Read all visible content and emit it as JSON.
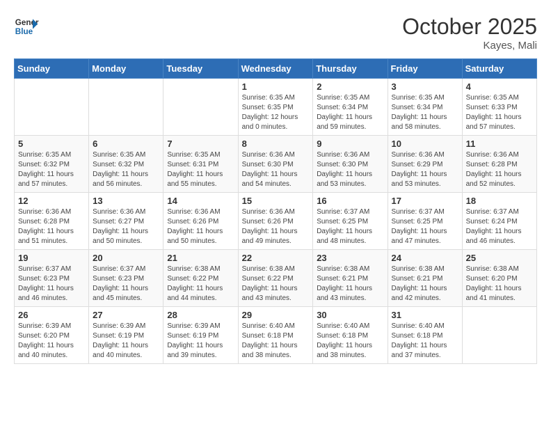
{
  "header": {
    "logo_line1": "General",
    "logo_line2": "Blue",
    "month": "October 2025",
    "location": "Kayes, Mali"
  },
  "weekdays": [
    "Sunday",
    "Monday",
    "Tuesday",
    "Wednesday",
    "Thursday",
    "Friday",
    "Saturday"
  ],
  "weeks": [
    [
      {
        "day": "",
        "info": ""
      },
      {
        "day": "",
        "info": ""
      },
      {
        "day": "",
        "info": ""
      },
      {
        "day": "1",
        "info": "Sunrise: 6:35 AM\nSunset: 6:35 PM\nDaylight: 12 hours\nand 0 minutes."
      },
      {
        "day": "2",
        "info": "Sunrise: 6:35 AM\nSunset: 6:34 PM\nDaylight: 11 hours\nand 59 minutes."
      },
      {
        "day": "3",
        "info": "Sunrise: 6:35 AM\nSunset: 6:34 PM\nDaylight: 11 hours\nand 58 minutes."
      },
      {
        "day": "4",
        "info": "Sunrise: 6:35 AM\nSunset: 6:33 PM\nDaylight: 11 hours\nand 57 minutes."
      }
    ],
    [
      {
        "day": "5",
        "info": "Sunrise: 6:35 AM\nSunset: 6:32 PM\nDaylight: 11 hours\nand 57 minutes."
      },
      {
        "day": "6",
        "info": "Sunrise: 6:35 AM\nSunset: 6:32 PM\nDaylight: 11 hours\nand 56 minutes."
      },
      {
        "day": "7",
        "info": "Sunrise: 6:35 AM\nSunset: 6:31 PM\nDaylight: 11 hours\nand 55 minutes."
      },
      {
        "day": "8",
        "info": "Sunrise: 6:36 AM\nSunset: 6:30 PM\nDaylight: 11 hours\nand 54 minutes."
      },
      {
        "day": "9",
        "info": "Sunrise: 6:36 AM\nSunset: 6:30 PM\nDaylight: 11 hours\nand 53 minutes."
      },
      {
        "day": "10",
        "info": "Sunrise: 6:36 AM\nSunset: 6:29 PM\nDaylight: 11 hours\nand 53 minutes."
      },
      {
        "day": "11",
        "info": "Sunrise: 6:36 AM\nSunset: 6:28 PM\nDaylight: 11 hours\nand 52 minutes."
      }
    ],
    [
      {
        "day": "12",
        "info": "Sunrise: 6:36 AM\nSunset: 6:28 PM\nDaylight: 11 hours\nand 51 minutes."
      },
      {
        "day": "13",
        "info": "Sunrise: 6:36 AM\nSunset: 6:27 PM\nDaylight: 11 hours\nand 50 minutes."
      },
      {
        "day": "14",
        "info": "Sunrise: 6:36 AM\nSunset: 6:26 PM\nDaylight: 11 hours\nand 50 minutes."
      },
      {
        "day": "15",
        "info": "Sunrise: 6:36 AM\nSunset: 6:26 PM\nDaylight: 11 hours\nand 49 minutes."
      },
      {
        "day": "16",
        "info": "Sunrise: 6:37 AM\nSunset: 6:25 PM\nDaylight: 11 hours\nand 48 minutes."
      },
      {
        "day": "17",
        "info": "Sunrise: 6:37 AM\nSunset: 6:25 PM\nDaylight: 11 hours\nand 47 minutes."
      },
      {
        "day": "18",
        "info": "Sunrise: 6:37 AM\nSunset: 6:24 PM\nDaylight: 11 hours\nand 46 minutes."
      }
    ],
    [
      {
        "day": "19",
        "info": "Sunrise: 6:37 AM\nSunset: 6:23 PM\nDaylight: 11 hours\nand 46 minutes."
      },
      {
        "day": "20",
        "info": "Sunrise: 6:37 AM\nSunset: 6:23 PM\nDaylight: 11 hours\nand 45 minutes."
      },
      {
        "day": "21",
        "info": "Sunrise: 6:38 AM\nSunset: 6:22 PM\nDaylight: 11 hours\nand 44 minutes."
      },
      {
        "day": "22",
        "info": "Sunrise: 6:38 AM\nSunset: 6:22 PM\nDaylight: 11 hours\nand 43 minutes."
      },
      {
        "day": "23",
        "info": "Sunrise: 6:38 AM\nSunset: 6:21 PM\nDaylight: 11 hours\nand 43 minutes."
      },
      {
        "day": "24",
        "info": "Sunrise: 6:38 AM\nSunset: 6:21 PM\nDaylight: 11 hours\nand 42 minutes."
      },
      {
        "day": "25",
        "info": "Sunrise: 6:38 AM\nSunset: 6:20 PM\nDaylight: 11 hours\nand 41 minutes."
      }
    ],
    [
      {
        "day": "26",
        "info": "Sunrise: 6:39 AM\nSunset: 6:20 PM\nDaylight: 11 hours\nand 40 minutes."
      },
      {
        "day": "27",
        "info": "Sunrise: 6:39 AM\nSunset: 6:19 PM\nDaylight: 11 hours\nand 40 minutes."
      },
      {
        "day": "28",
        "info": "Sunrise: 6:39 AM\nSunset: 6:19 PM\nDaylight: 11 hours\nand 39 minutes."
      },
      {
        "day": "29",
        "info": "Sunrise: 6:40 AM\nSunset: 6:18 PM\nDaylight: 11 hours\nand 38 minutes."
      },
      {
        "day": "30",
        "info": "Sunrise: 6:40 AM\nSunset: 6:18 PM\nDaylight: 11 hours\nand 38 minutes."
      },
      {
        "day": "31",
        "info": "Sunrise: 6:40 AM\nSunset: 6:18 PM\nDaylight: 11 hours\nand 37 minutes."
      },
      {
        "day": "",
        "info": ""
      }
    ]
  ]
}
